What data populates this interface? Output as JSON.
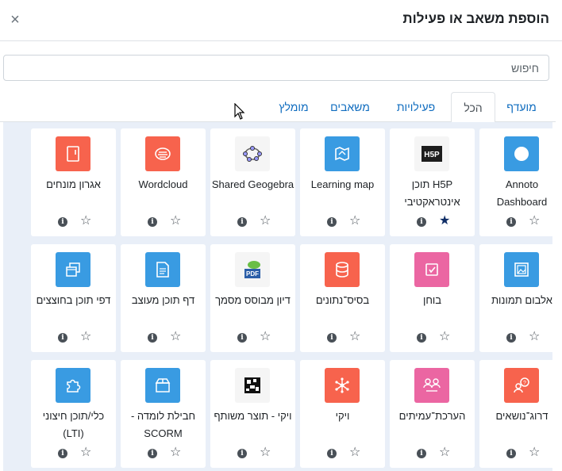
{
  "dialog": {
    "title": "הוספת משאב או פעילות",
    "close_label": "×"
  },
  "search": {
    "placeholder": "חיפוש"
  },
  "tabs": [
    {
      "label": "מועדף"
    },
    {
      "label": "הכל"
    },
    {
      "label": "פעילויות"
    },
    {
      "label": "משאבים"
    },
    {
      "label": "מומלץ"
    }
  ],
  "active_tab": "הכל",
  "cards": [
    {
      "label": "Annoto Dashboard",
      "icon": "annoto-icon",
      "color": "#399be2",
      "starred": false
    },
    {
      "label": "H5P תוכן אינטראקטיבי",
      "icon": "h5p-icon",
      "color": "#f5f5f5",
      "starred": true
    },
    {
      "label": "Learning map",
      "icon": "learning-map-icon",
      "color": "#399be2",
      "starred": false
    },
    {
      "label": "Shared Geogebra",
      "icon": "geogebra-icon",
      "color": "#f5f5f5",
      "starred": false
    },
    {
      "label": "Wordcloud",
      "icon": "wordcloud-icon",
      "color": "#f7634d",
      "starred": false
    },
    {
      "label": "אגרון מונחים",
      "icon": "glossary-icon",
      "color": "#f7634d",
      "starred": false
    },
    {
      "label": "אלבום תמונות",
      "icon": "image-gallery-icon",
      "color": "#399be2",
      "starred": false
    },
    {
      "label": "בוחן",
      "icon": "quiz-icon",
      "color": "#eb66a2",
      "starred": false
    },
    {
      "label": "בסיס־נתונים",
      "icon": "database-icon",
      "color": "#f7634d",
      "starred": false
    },
    {
      "label": "דיון מבוסס מסמך",
      "icon": "pdf-icon",
      "color": "#f5f5f5",
      "starred": false
    },
    {
      "label": "דף תוכן מעוצב",
      "icon": "page-icon",
      "color": "#399be2",
      "starred": false
    },
    {
      "label": "דפי תוכן בחוצצים",
      "icon": "tabbed-pages-icon",
      "color": "#399be2",
      "starred": false
    },
    {
      "label": "דרוג־נושאים",
      "icon": "choice-icon",
      "color": "#f7634d",
      "starred": false
    },
    {
      "label": "הערכת־עמיתים",
      "icon": "workshop-icon",
      "color": "#eb66a2",
      "starred": false
    },
    {
      "label": "ויקי",
      "icon": "wiki-icon",
      "color": "#f7634d",
      "starred": false
    },
    {
      "label": "ויקי - תוצר משותף",
      "icon": "ouwiki-icon",
      "color": "#f5f5f5",
      "starred": false
    },
    {
      "label": "חבילת לומדה - SCORM",
      "icon": "scorm-icon",
      "color": "#399be2",
      "starred": false
    },
    {
      "label": "כלי/תוכן חיצוני (LTI)",
      "icon": "lti-puzzle-icon",
      "color": "#399be2",
      "starred": false
    }
  ],
  "info_glyph": "i",
  "star_glyph": "☆",
  "star_filled_glyph": "★"
}
